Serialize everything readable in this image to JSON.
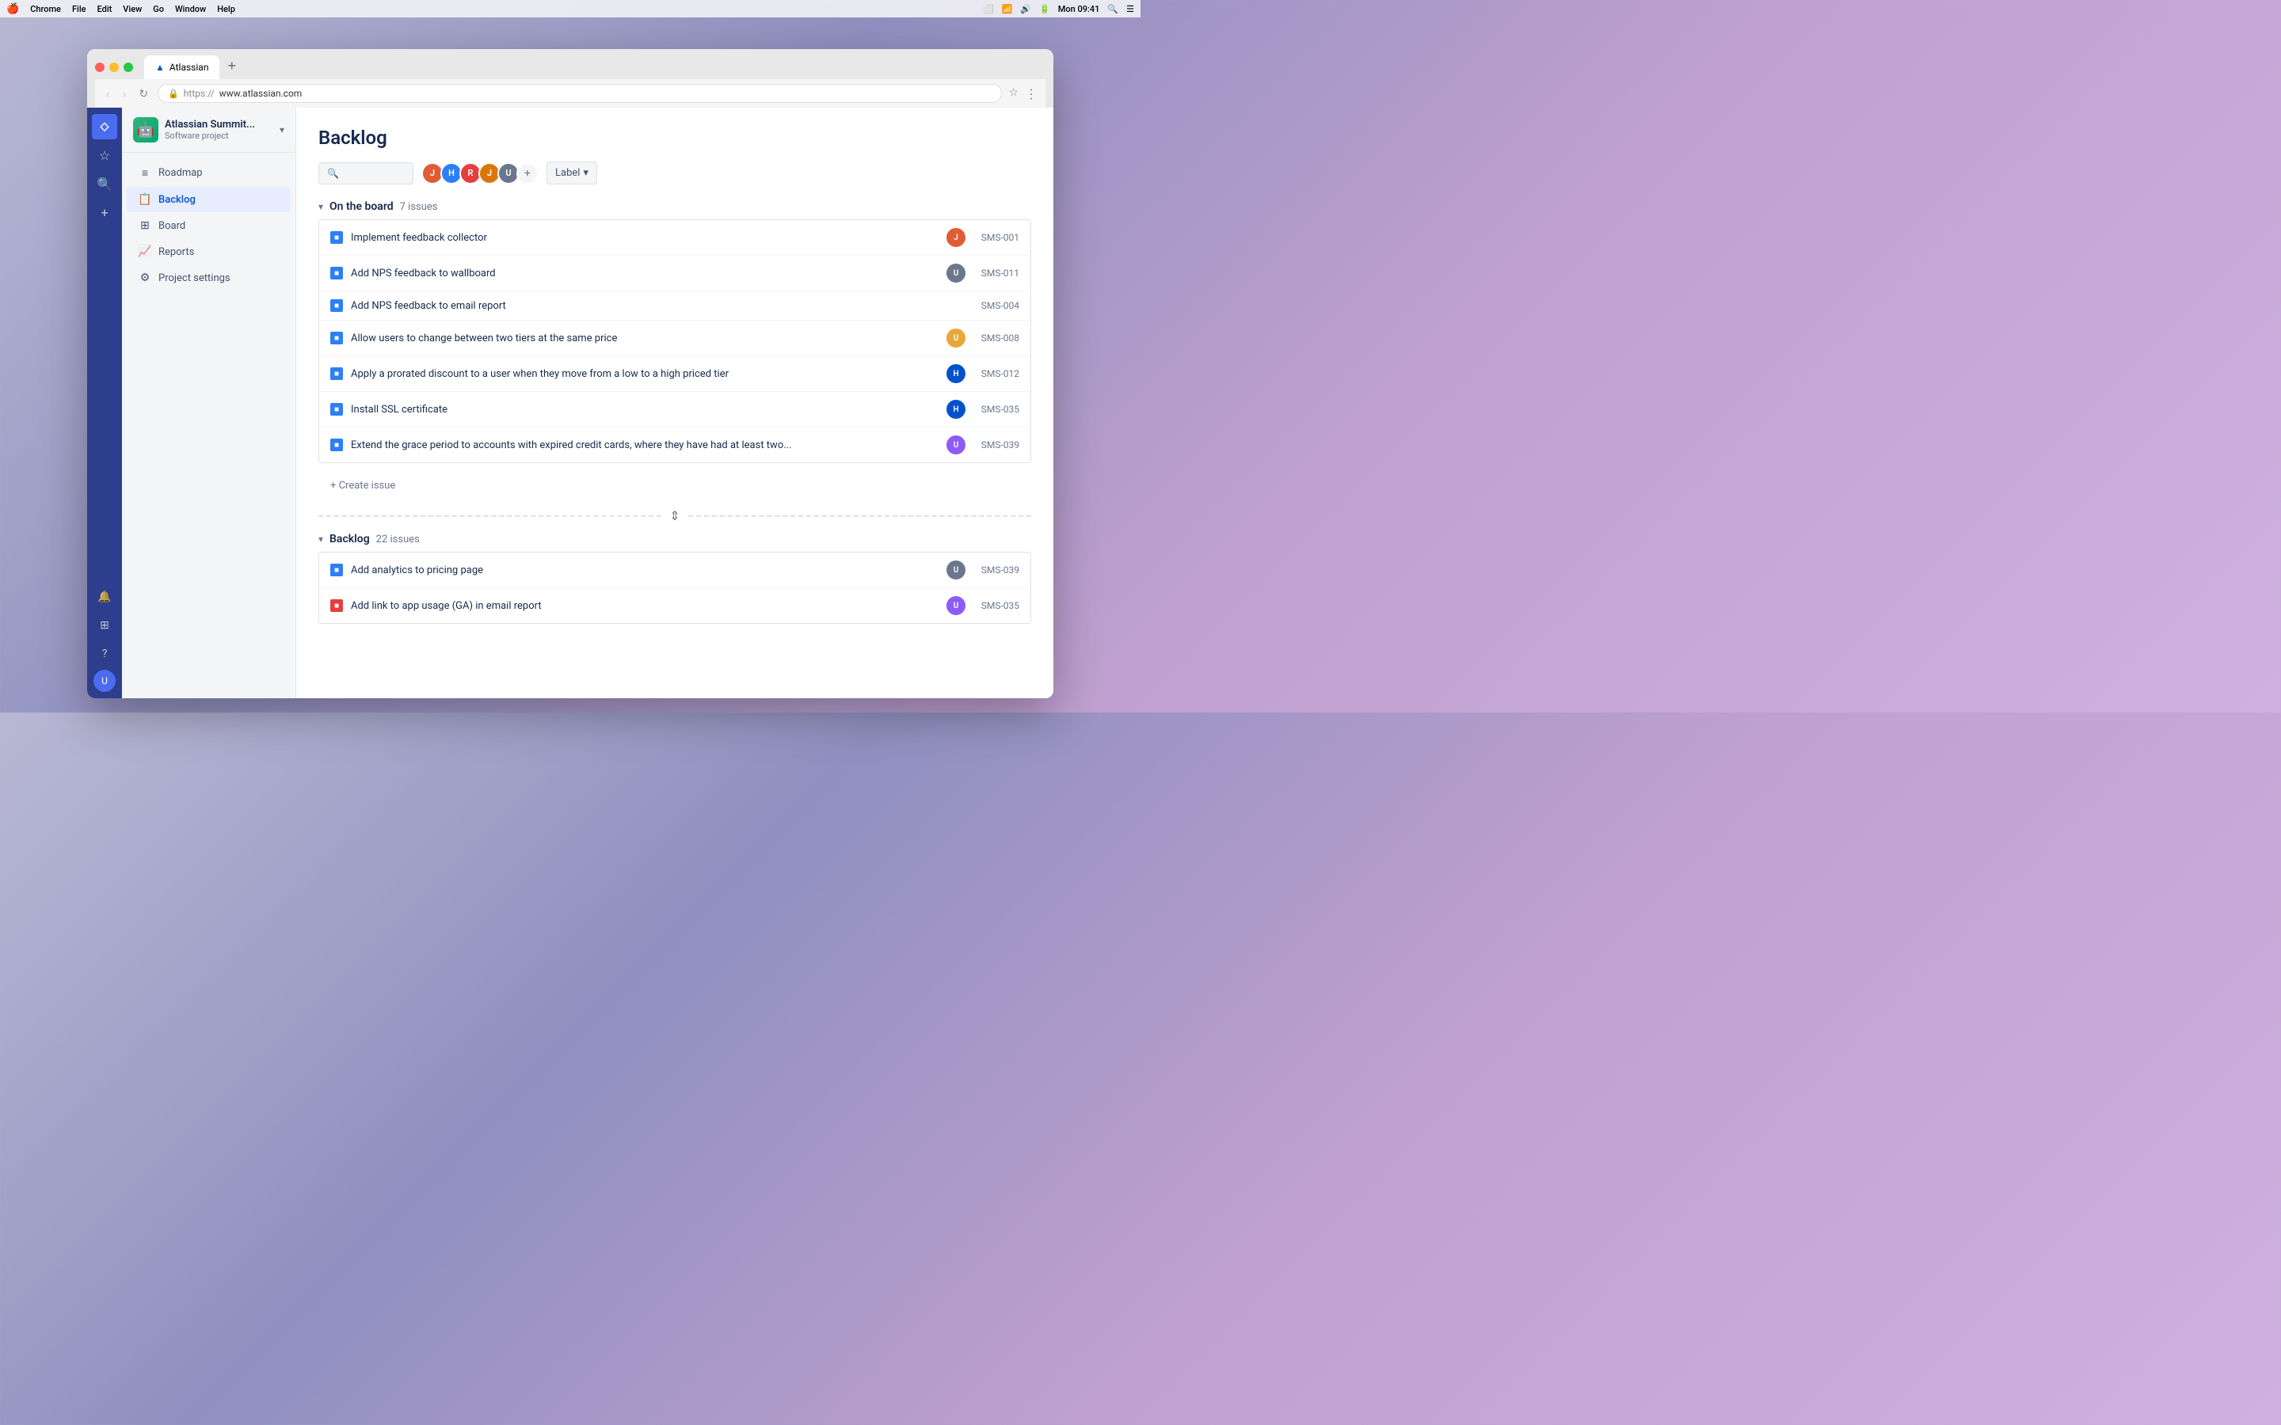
{
  "menubar": {
    "apple": "🍎",
    "items": [
      "Chrome",
      "File",
      "Edit",
      "View",
      "Go",
      "Window",
      "Help"
    ],
    "time": "Mon 09:41",
    "battery": "🔋"
  },
  "browser": {
    "tab_title": "Atlassian",
    "url_protocol": "https://",
    "url_domain": "www.atlassian.com",
    "new_tab_label": "+"
  },
  "atlassian_sidebar": {
    "icons": [
      "◇",
      "☆",
      "🔍",
      "+"
    ],
    "bottom_icons": [
      "🔔",
      "⊞",
      "?"
    ]
  },
  "project": {
    "name": "Atlassian Summit...",
    "type": "Software project"
  },
  "nav": {
    "items": [
      {
        "id": "roadmap",
        "label": "Roadmap",
        "icon": "≡"
      },
      {
        "id": "backlog",
        "label": "Backlog",
        "icon": "📋"
      },
      {
        "id": "board",
        "label": "Board",
        "icon": "⊞"
      },
      {
        "id": "reports",
        "label": "Reports",
        "icon": "📈"
      },
      {
        "id": "settings",
        "label": "Project settings",
        "icon": "⚙"
      }
    ]
  },
  "page": {
    "title": "Backlog",
    "filter": {
      "label_btn": "Label",
      "search_placeholder": ""
    }
  },
  "on_the_board": {
    "title": "On the board",
    "count": "7 issues",
    "issues": [
      {
        "id": "SMS-001",
        "title": "Implement feedback collector",
        "type": "story",
        "assignee_color": "#e05c35",
        "assignee_initial": "J",
        "has_assignee": true
      },
      {
        "id": "SMS-011",
        "title": "Add NPS feedback to wallboard",
        "type": "story",
        "assignee_color": "#6b778c",
        "assignee_initial": "U",
        "has_assignee": true,
        "assignee_img": true
      },
      {
        "id": "SMS-004",
        "title": "Add NPS feedback to email report",
        "type": "story",
        "has_assignee": false
      },
      {
        "id": "SMS-008",
        "title": "Allow users to change between two tiers at the same price",
        "type": "story",
        "assignee_color": "#e8a838",
        "assignee_initial": "U",
        "has_assignee": true,
        "assignee_img": true
      },
      {
        "id": "SMS-012",
        "title": "Apply a prorated discount to a user when they move from a low to a high priced tier",
        "type": "story",
        "assignee_color": "#0052cc",
        "assignee_initial": "H",
        "has_assignee": true
      },
      {
        "id": "SMS-035",
        "title": "Install SSL certificate",
        "type": "story",
        "assignee_color": "#0052cc",
        "assignee_initial": "H",
        "has_assignee": true
      },
      {
        "id": "SMS-039",
        "title": "Extend the grace period to accounts with expired credit cards, where they have had at least two...",
        "type": "story",
        "assignee_color": "#8b5cf6",
        "assignee_initial": "U",
        "has_assignee": true,
        "assignee_img": true
      }
    ],
    "create_issue_label": "+ Create issue"
  },
  "backlog_section": {
    "title": "Backlog",
    "count": "22 issues",
    "issues": [
      {
        "id": "SMS-039",
        "title": "Add analytics to pricing page",
        "type": "story",
        "assignee_color": "#6b778c",
        "assignee_initial": "U",
        "has_assignee": true,
        "assignee_img": true
      },
      {
        "id": "SMS-035",
        "title": "Add link to app usage (GA) in email report",
        "type": "bug",
        "assignee_color": "#8b5cf6",
        "assignee_initial": "U",
        "has_assignee": true,
        "assignee_img": true
      }
    ]
  },
  "users": [
    {
      "color": "#e05c35",
      "initial": "J"
    },
    {
      "color": "#2d7ff9",
      "initial": "H"
    },
    {
      "color": "#e53e3e",
      "initial": "R"
    },
    {
      "color": "#e05c35",
      "initial": "J"
    },
    {
      "color": "#6b778c",
      "initial": "U"
    }
  ]
}
